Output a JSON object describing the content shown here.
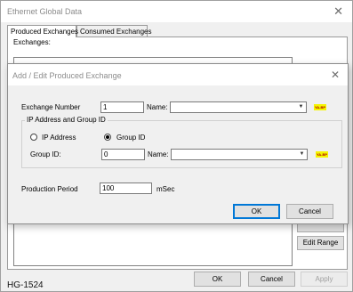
{
  "outer": {
    "title": "Ethernet Global Data",
    "close_glyph": "✕",
    "tabs": [
      "Produced Exchanges",
      "Consumed Exchanges"
    ],
    "exchanges_label": "Exchanges:",
    "side_buttons": {
      "edit_range": "Edit Range"
    },
    "buttons": {
      "ok": "OK",
      "cancel": "Cancel",
      "apply": "Apply"
    },
    "status_label": "HG-1524"
  },
  "inner": {
    "title": "Add / Edit Produced Exchange",
    "close_glyph": "✕",
    "exchange_number_label": "Exchange Number",
    "exchange_number_value": "1",
    "name_label": "Name:",
    "name_value": "",
    "ip_group_title": "IP Address and Group ID",
    "radio_ip_label": "IP Address",
    "radio_group_label": "Group ID",
    "radio_selected": "group_id",
    "group_id_label": "Group ID:",
    "group_id_value": "0",
    "group_name_label": "Name:",
    "group_name_value": "",
    "production_period_label": "Production Period",
    "production_period_value": "100",
    "production_period_unit": "mSec",
    "buttons": {
      "ok": "OK",
      "cancel": "Cancel"
    },
    "highlight_tag": "ΥΑ-ΒΡ"
  },
  "colors": {
    "highlight": "#f5f500",
    "focus_border": "#0078d7"
  }
}
